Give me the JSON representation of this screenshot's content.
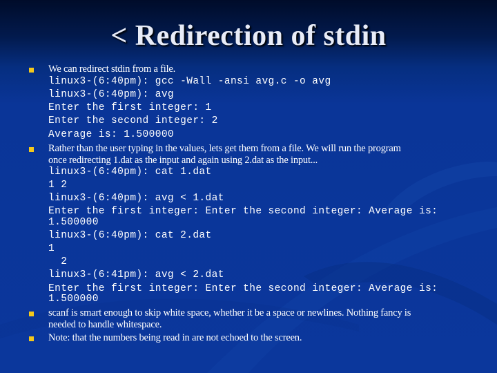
{
  "slide": {
    "title": "< Redirection of stdin",
    "bullet_color": "#f4c81c",
    "bullets": [
      {
        "text": "We can redirect stdin from a file.",
        "code": [
          "linux3-(6:40pm): gcc -Wall -ansi avg.c -o avg",
          "linux3-(6:40pm): avg",
          "Enter the first integer: 1",
          "Enter the second integer: 2",
          "Average is: 1.500000"
        ]
      },
      {
        "text_lines": [
          "Rather than the user typing in the values, lets get them from a file. We will run the program",
          "once redirecting 1.dat as the input and again using 2.dat as the input..."
        ],
        "code": [
          "linux3-(6:40pm): cat 1.dat",
          "1 2",
          "linux3-(6:40pm): avg < 1.dat",
          "Enter the first integer: Enter the second integer: Average is:",
          "1.500000",
          "linux3-(6:40pm): cat 2.dat",
          "1",
          "  2",
          "linux3-(6:41pm): avg < 2.dat",
          "Enter the first integer: Enter the second integer: Average is:",
          "1.500000"
        ]
      },
      {
        "text_lines": [
          "scanf is smart enough to skip white space, whether it be a space or newlines. Nothing fancy is",
          "needed to handle whitespace."
        ]
      },
      {
        "text": "Note: that the numbers being read in are not echoed to the screen."
      }
    ]
  }
}
